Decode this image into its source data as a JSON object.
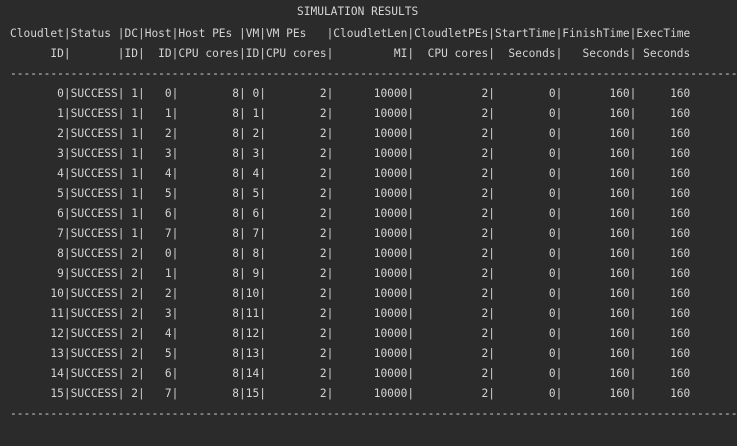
{
  "title": "SIMULATION RESULTS",
  "header_line1": "Cloudlet|Status |DC|Host|Host PEs |VM|VM PEs   |CloudletLen|CloudletPEs|StartTime|FinishTime|ExecTime",
  "header_line2": "      ID|       |ID|  ID|CPU cores|ID|CPU cores|         MI|  CPU cores|  Seconds|   Seconds| Seconds",
  "separator": "-------------------------------------------------------------------------------------------------------------",
  "rows": [
    "       0|SUCCESS| 1|   0|        8| 0|        2|      10000|          2|        0|       160|     160",
    "       1|SUCCESS| 1|   1|        8| 1|        2|      10000|          2|        0|       160|     160",
    "       2|SUCCESS| 1|   2|        8| 2|        2|      10000|          2|        0|       160|     160",
    "       3|SUCCESS| 1|   3|        8| 3|        2|      10000|          2|        0|       160|     160",
    "       4|SUCCESS| 1|   4|        8| 4|        2|      10000|          2|        0|       160|     160",
    "       5|SUCCESS| 1|   5|        8| 5|        2|      10000|          2|        0|       160|     160",
    "       6|SUCCESS| 1|   6|        8| 6|        2|      10000|          2|        0|       160|     160",
    "       7|SUCCESS| 1|   7|        8| 7|        2|      10000|          2|        0|       160|     160",
    "       8|SUCCESS| 2|   0|        8| 8|        2|      10000|          2|        0|       160|     160",
    "       9|SUCCESS| 2|   1|        8| 9|        2|      10000|          2|        0|       160|     160",
    "      10|SUCCESS| 2|   2|        8|10|        2|      10000|          2|        0|       160|     160",
    "      11|SUCCESS| 2|   3|        8|11|        2|      10000|          2|        0|       160|     160",
    "      12|SUCCESS| 2|   4|        8|12|        2|      10000|          2|        0|       160|     160",
    "      13|SUCCESS| 2|   5|        8|13|        2|      10000|          2|        0|       160|     160",
    "      14|SUCCESS| 2|   6|        8|14|        2|      10000|          2|        0|       160|     160",
    "      15|SUCCESS| 2|   7|        8|15|        2|      10000|          2|        0|       160|     160"
  ],
  "colors": {
    "background": "#2b2b2b",
    "text": "#d4d4d4"
  }
}
